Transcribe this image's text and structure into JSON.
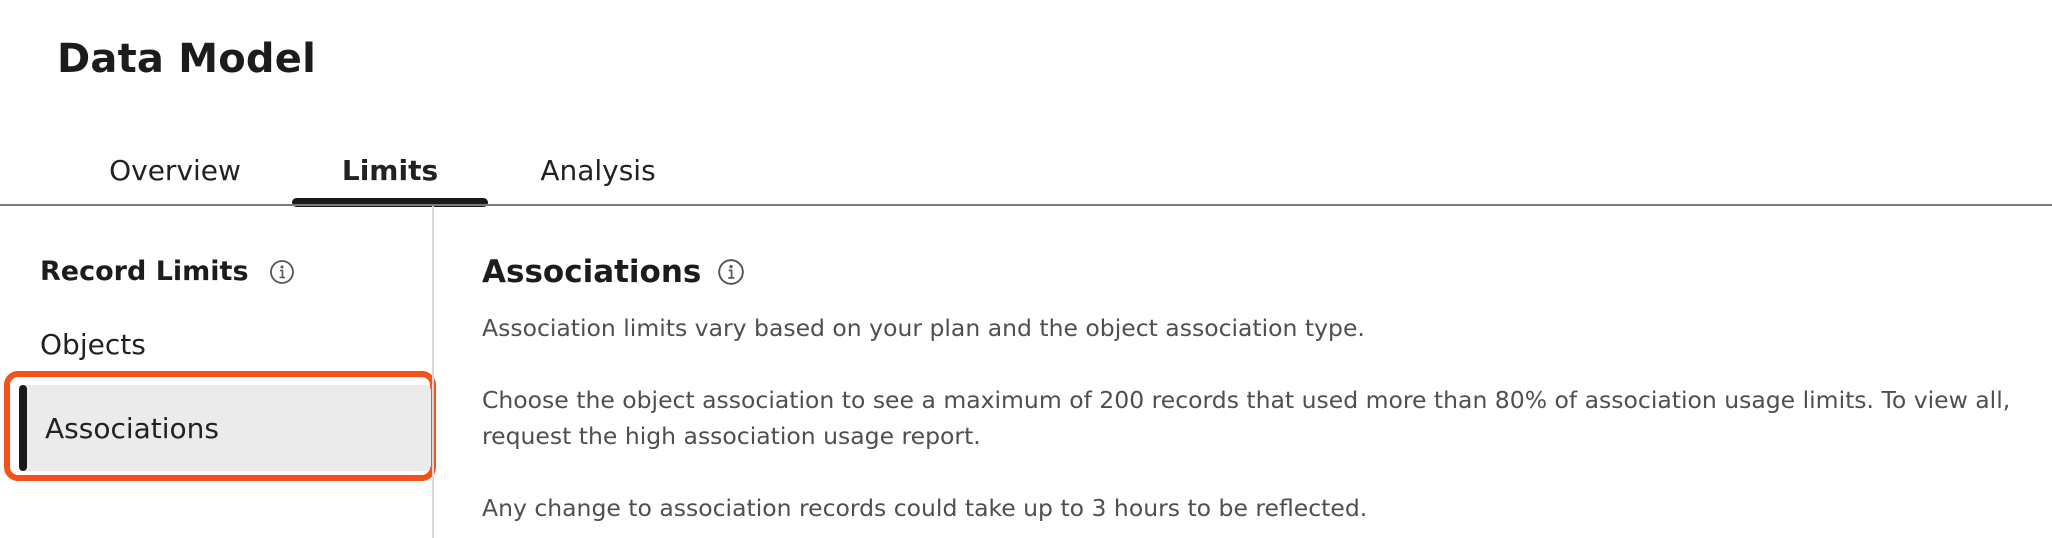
{
  "page": {
    "title": "Data Model"
  },
  "tabs": [
    {
      "label": "Overview",
      "active": false
    },
    {
      "label": "Limits",
      "active": true
    },
    {
      "label": "Analysis",
      "active": false
    }
  ],
  "sidebar": {
    "heading": "Record Limits",
    "heading_icon": "info-icon",
    "items": [
      {
        "label": "Objects",
        "selected": false
      },
      {
        "label": "Associations",
        "selected": true
      }
    ],
    "highlight_color": "#f2531a"
  },
  "main": {
    "title": "Associations",
    "title_icon": "info-icon",
    "paragraphs": [
      "Association limits vary based on your plan and the object association type.",
      "Choose the object association to see a maximum of 200 records that used more than 80% of association usage limits. To view all, request the high association usage report.",
      "Any change to association records could take up to 3 hours to be reflected."
    ]
  }
}
